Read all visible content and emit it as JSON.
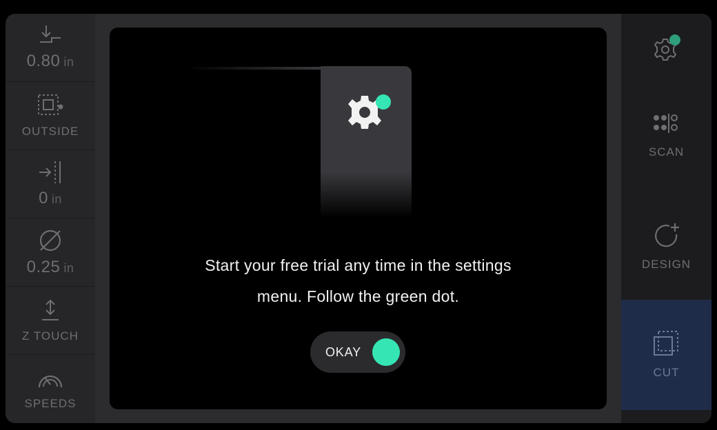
{
  "colors": {
    "accent": "#35e6b4",
    "active_tab": "#1f2c49",
    "modal_bg": "#000000"
  },
  "left_bar": {
    "items": [
      {
        "icon": "step-down-icon",
        "value": "0.80",
        "unit": "in"
      },
      {
        "icon": "outside-cut-icon",
        "label": "OUTSIDE"
      },
      {
        "icon": "offset-icon",
        "value": "0",
        "unit": "in"
      },
      {
        "icon": "diameter-icon",
        "value": "0.25",
        "unit": "in"
      },
      {
        "icon": "z-touch-icon",
        "label": "Z TOUCH"
      },
      {
        "icon": "speedometer-icon",
        "label": "SPEEDS"
      }
    ]
  },
  "right_bar": {
    "settings": {
      "icon": "gear-icon"
    },
    "scan": {
      "icon": "scan-icon",
      "label": "SCAN"
    },
    "design": {
      "icon": "design-add-icon",
      "label": "DESIGN"
    },
    "cut": {
      "icon": "cut-icon",
      "label": "CUT"
    }
  },
  "modal": {
    "message_line1": "Start your free trial any time in the settings",
    "message_line2": "menu. Follow the green dot.",
    "okay_label": "OKAY"
  }
}
